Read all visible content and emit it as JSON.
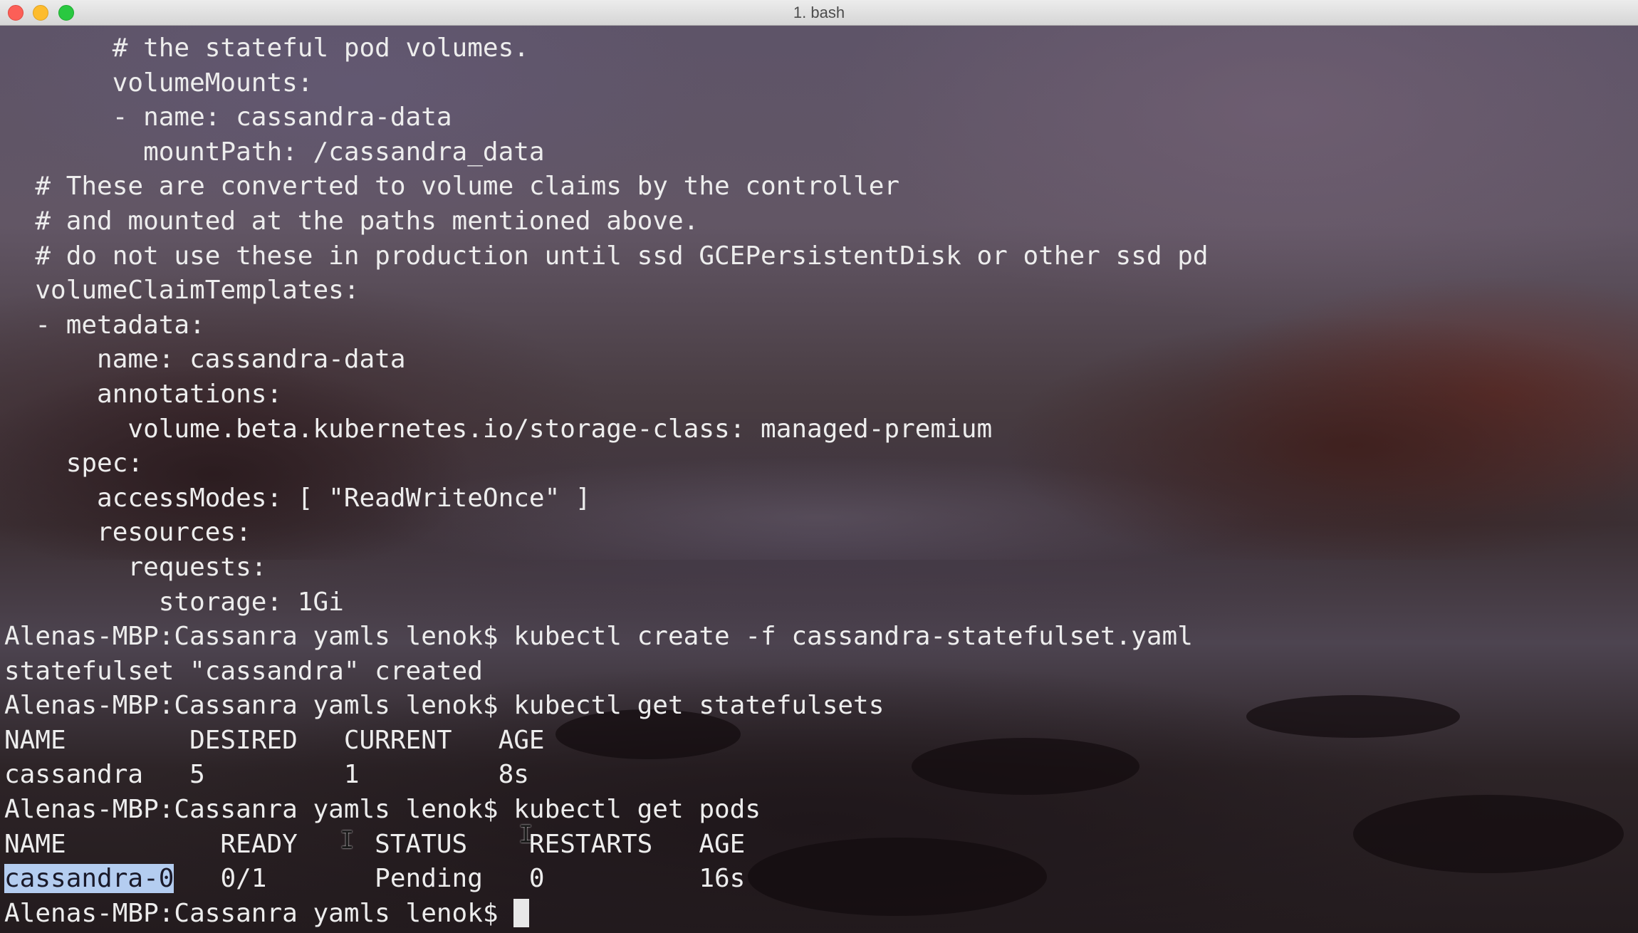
{
  "window": {
    "title": "1. bash"
  },
  "terminal": {
    "lines": [
      {
        "text": "       # the stateful pod volumes."
      },
      {
        "text": "       volumeMounts:"
      },
      {
        "text": "       - name: cassandra-data"
      },
      {
        "text": "         mountPath: /cassandra_data"
      },
      {
        "text": "  # These are converted to volume claims by the controller"
      },
      {
        "text": "  # and mounted at the paths mentioned above."
      },
      {
        "text": "  # do not use these in production until ssd GCEPersistentDisk or other ssd pd"
      },
      {
        "text": "  volumeClaimTemplates:"
      },
      {
        "text": "  - metadata:"
      },
      {
        "text": "      name: cassandra-data"
      },
      {
        "text": "      annotations:"
      },
      {
        "text": "        volume.beta.kubernetes.io/storage-class: managed-premium"
      },
      {
        "text": "    spec:"
      },
      {
        "text": "      accessModes: [ \"ReadWriteOnce\" ]"
      },
      {
        "text": "      resources:"
      },
      {
        "text": "        requests:"
      },
      {
        "text": "          storage: 1Gi"
      },
      {
        "text": "Alenas-MBP:Cassanra yamls lenok$ kubectl create -f cassandra-statefulset.yaml"
      },
      {
        "text": "statefulset \"cassandra\" created"
      },
      {
        "text": "Alenas-MBP:Cassanra yamls lenok$ kubectl get statefulsets"
      },
      {
        "text": "NAME        DESIRED   CURRENT   AGE"
      },
      {
        "text": "cassandra   5         1         8s"
      },
      {
        "text": "Alenas-MBP:Cassanra yamls lenok$ kubectl get pods"
      },
      {
        "text": "NAME          READY     STATUS    RESTARTS   AGE"
      }
    ],
    "pod_row": {
      "selected_text": "cassandra-0",
      "rest": "   0/1       Pending   0          16s"
    },
    "prompt": "Alenas-MBP:Cassanra yamls lenok$ "
  }
}
